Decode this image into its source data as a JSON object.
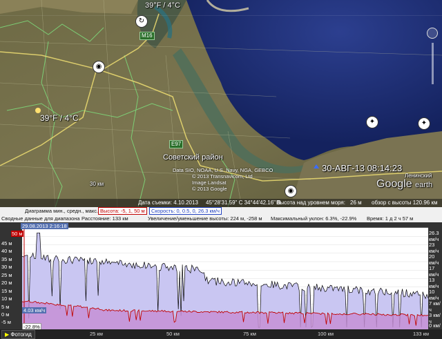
{
  "map": {
    "weather_top": "39°F / 4°C",
    "weather_left": "39°F / 4°C",
    "road_m16": "M16",
    "road_e97": "E97",
    "region_label": "Советский район",
    "attribution": [
      "Data SIO, NOAA, U.S. Navy, NGA, GEBCO",
      "© 2013 Transnavicom, Ltd",
      "Image Landsat",
      "© 2013 Google"
    ],
    "timestamp_overlay": "30-АВГ-13 08:14:23",
    "scale_label": "30 км",
    "town_right": "Ленинский",
    "logo_text": "Google",
    "logo_earth": "earth"
  },
  "statusbar": {
    "image_date": "Дата съемки: 4.10.2013",
    "coords": "45°28'31.59\" С   34°44'42.16\" В",
    "elevation_label": "Высота над уровнем моря:",
    "elevation_value": "26 м",
    "eye_alt": "обзор с высоты 120.96 км"
  },
  "profile": {
    "row1": {
      "label": "Диаграмма мин., средн., макс.:",
      "altitude": "Высота: -5, 1, 50 м",
      "speed": "Скорость: 0, 0.5, 0, 26.3 км/ч"
    },
    "row2": {
      "summary": "Сводные данные для диапазона",
      "distance": "Расстояние: 133 км",
      "gain_loss": "Увеличение/уменьшение высоты: 224 м, -258 м",
      "slope": "Максимальный уклон: 6.3%, -22.9%",
      "time": "Время: 1 д 2 ч 57 м"
    },
    "cursor_datetime": "29.08.2013 2:16:18",
    "left_ticks": [
      "50 м",
      "45 м",
      "40 м",
      "35 м",
      "30 м",
      "25 м",
      "20 м",
      "15 м",
      "10 м",
      "5 м",
      "0 м",
      "-5 м"
    ],
    "left_top_value": "50 м",
    "right_ticks": [
      "26.3 км/ч",
      "23 км/ч",
      "20 км/ч",
      "17 км/ч",
      "13 км/ч",
      "10 км/ч",
      "7 км/ч",
      "3 км/ч",
      "0 км/ч"
    ],
    "speed_marker": "4.03 км/ч",
    "slope_marker": "-22.8%",
    "x_ticks": [
      "25 км",
      "50 км",
      "75 км",
      "100 км",
      "133 км"
    ],
    "photo_button": "Фотогид",
    "colors": {
      "altitude_fill": "#c9c6f2",
      "speed_fill": "#c58fd6",
      "altitude_line": "#000000",
      "speed_line": "#c00000"
    }
  }
}
